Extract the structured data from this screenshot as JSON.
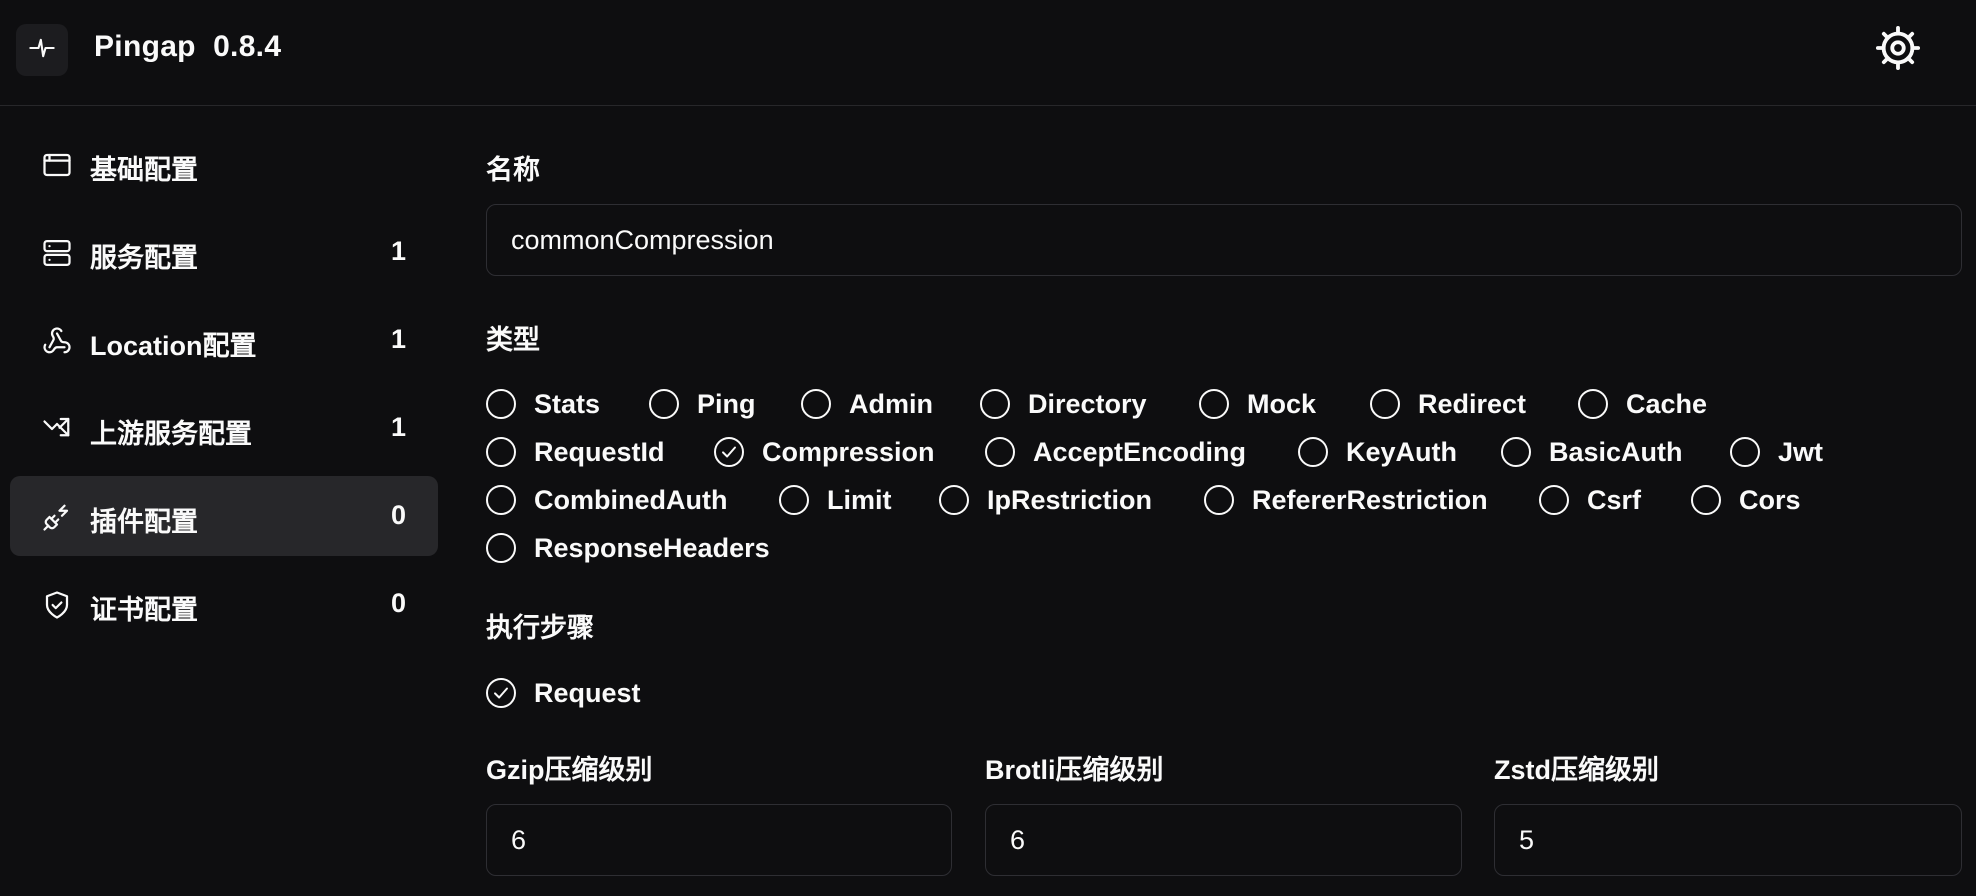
{
  "header": {
    "app_name": "Pingap  0.8.4",
    "logo_icon": "pulse-icon",
    "settings_icon": "gear-icon"
  },
  "sidebar": {
    "items": [
      {
        "label": "基础配置",
        "count": "",
        "icon": "app-window-icon",
        "active": false
      },
      {
        "label": "服务配置",
        "count": "1",
        "icon": "server-icon",
        "active": false
      },
      {
        "label": "Location配置",
        "count": "1",
        "icon": "webhook-icon",
        "active": false
      },
      {
        "label": "上游服务配置",
        "count": "1",
        "icon": "split-arrow-icon",
        "active": false
      },
      {
        "label": "插件配置",
        "count": "0",
        "icon": "plug-icon",
        "active": true
      },
      {
        "label": "证书配置",
        "count": "0",
        "icon": "shield-check-icon",
        "active": false
      }
    ]
  },
  "form": {
    "name_label": "名称",
    "name_value": "commonCompression",
    "type_label": "类型",
    "types": [
      {
        "label": "Stats",
        "checked": false
      },
      {
        "label": "Ping",
        "checked": false
      },
      {
        "label": "Admin",
        "checked": false
      },
      {
        "label": "Directory",
        "checked": false
      },
      {
        "label": "Mock",
        "checked": false
      },
      {
        "label": "Redirect",
        "checked": false
      },
      {
        "label": "Cache",
        "checked": false
      },
      {
        "label": "RequestId",
        "checked": false
      },
      {
        "label": "Compression",
        "checked": true
      },
      {
        "label": "AcceptEncoding",
        "checked": false
      },
      {
        "label": "KeyAuth",
        "checked": false
      },
      {
        "label": "BasicAuth",
        "checked": false
      },
      {
        "label": "Jwt",
        "checked": false
      },
      {
        "label": "CombinedAuth",
        "checked": false
      },
      {
        "label": "Limit",
        "checked": false
      },
      {
        "label": "IpRestriction",
        "checked": false
      },
      {
        "label": "RefererRestriction",
        "checked": false
      },
      {
        "label": "Csrf",
        "checked": false
      },
      {
        "label": "Cors",
        "checked": false
      },
      {
        "label": "ResponseHeaders",
        "checked": false
      }
    ],
    "step_label": "执行步骤",
    "steps": [
      {
        "label": "Request",
        "checked": true
      }
    ],
    "gzip_label": "Gzip压缩级别",
    "gzip_value": "6",
    "brotli_label": "Brotli压缩级别",
    "brotli_value": "6",
    "zstd_label": "Zstd压缩级别",
    "zstd_value": "5"
  }
}
